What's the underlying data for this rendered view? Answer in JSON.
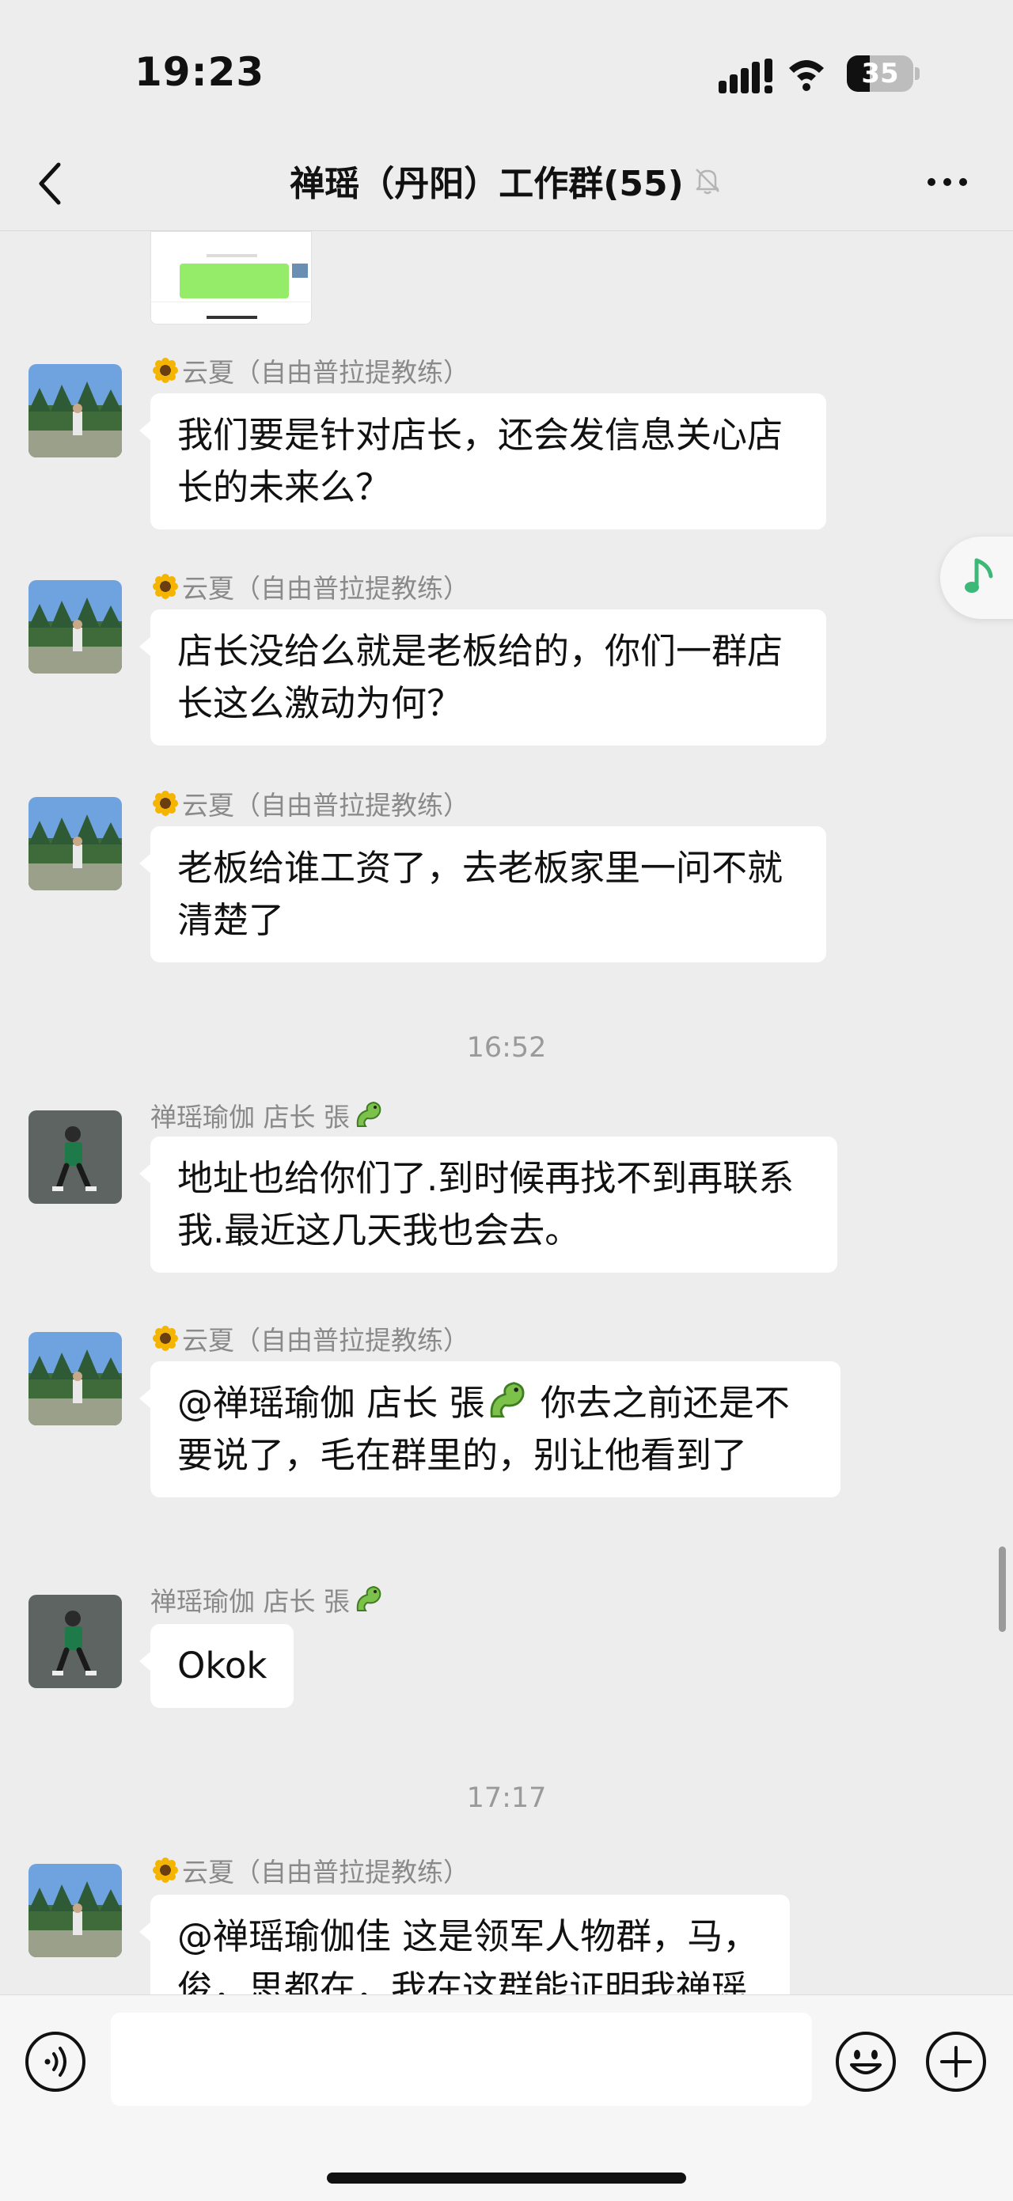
{
  "status_bar": {
    "time": "19:23",
    "battery_level": "35",
    "battery_fraction": 0.35
  },
  "nav": {
    "title": "禅瑶（丹阳）工作群(55)",
    "muted": true
  },
  "colors": {
    "background": "#ededed",
    "bubble": "#ffffff",
    "sender_text": "#8a8a8a",
    "music_accent": "#3cb878"
  },
  "messages": [
    {
      "sender": "云夏（自由普拉提教练）",
      "sender_icon": "sunflower-icon",
      "text": "我们要是针对店长，还会发信息关心店长的未来么？"
    },
    {
      "sender": "云夏（自由普拉提教练）",
      "sender_icon": "sunflower-icon",
      "text": "店长没给么就是老板给的，你们一群店长这么激动为何？"
    },
    {
      "sender": "云夏（自由普拉提教练）",
      "sender_icon": "sunflower-icon",
      "text": "老板给谁工资了，去老板家里一问不就清楚了"
    },
    {
      "sender": "禅瑶瑜伽  店长 張",
      "sender_icon": "dragon-emoji-icon",
      "text": "地址也给你们了.到时候再找不到再联系我.最近这几天我也会去。"
    },
    {
      "sender": "云夏（自由普拉提教练）",
      "sender_icon": "sunflower-icon",
      "text_parts": [
        "@禅瑶瑜伽  店长 張",
        " 你去之前还是不要说了，毛在群里的，别让他看到了"
      ]
    },
    {
      "sender": "禅瑶瑜伽  店长 張",
      "sender_icon": "dragon-emoji-icon",
      "text": "Okok"
    },
    {
      "sender": "云夏（自由普拉提教练）",
      "sender_icon": "sunflower-icon",
      "text_visible": "@禅瑶瑜伽佳 这是领军人物群，马，俊，思都在，我在这群能证明我禅瑶"
    }
  ],
  "timestamps": [
    "16:52",
    "17:17"
  ],
  "input_bar": {
    "placeholder": ""
  }
}
